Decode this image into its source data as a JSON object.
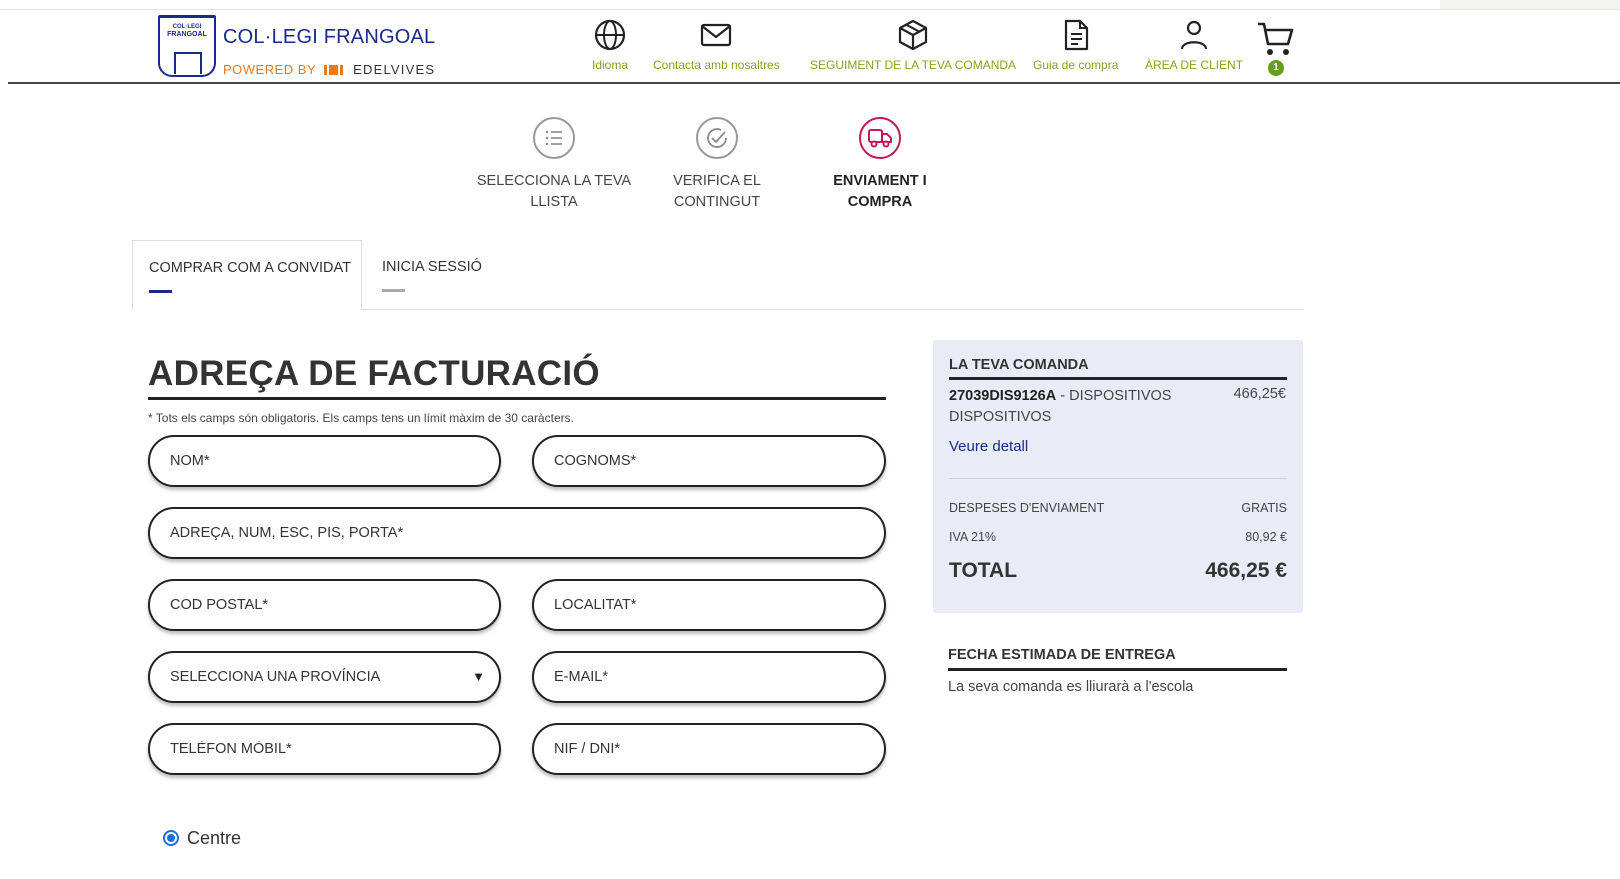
{
  "header": {
    "logo_line1": "COL·LEGI",
    "logo_line2": "FRANGOAL",
    "school_name": "COL·LEGI FRANGOAL",
    "powered_by": "POWERED BY",
    "brand": "EDELVIVES",
    "nav": [
      {
        "label": "Idioma",
        "icon": "globe-icon"
      },
      {
        "label": "Contacta amb nosaltres",
        "icon": "mail-icon"
      },
      {
        "label": "SEGUIMENT DE LA TEVA COMANDA",
        "icon": "package-icon"
      },
      {
        "label": "Guia de compra",
        "icon": "document-icon"
      },
      {
        "label": "ÀREA DE CLIENT",
        "icon": "user-icon"
      }
    ],
    "cart_count": "1",
    "colors": {
      "brand_blue": "#1a2a8c",
      "nav_green": "#8aa020",
      "accent_orange": "#e87a1e",
      "active_step": "#c2185b"
    }
  },
  "steps": [
    {
      "line1": "SELECCIONA LA TEVA",
      "line2": "LLISTA",
      "icon": "list-icon",
      "active": false
    },
    {
      "line1": "VERIFICA EL",
      "line2": "CONTINGUT",
      "icon": "check-circle-icon",
      "active": false
    },
    {
      "line1": "ENVIAMENT I COMPRA",
      "line2": "",
      "icon": "truck-icon",
      "active": true
    }
  ],
  "tabs": [
    {
      "label": "COMPRAR COM A CONVIDAT",
      "active": true
    },
    {
      "label": "INICIA SESSIÓ",
      "active": false
    }
  ],
  "billing": {
    "title": "ADREÇA DE FACTURACIÓ",
    "note": "* Tots els camps són obligatoris. Els camps tens un límit màxim de 30 caràcters.",
    "fields": {
      "nom": "NOM*",
      "cognoms": "COGNOMS*",
      "adreca": "ADREÇA, NUM, ESC, PIS, PORTA*",
      "cod_postal": "COD POSTAL*",
      "localitat": "LOCALITAT*",
      "provincia": "SELECCIONA UNA PROVÍNCIA",
      "email": "E-MAIL*",
      "telefon": "TELÈFON MÒBIL*",
      "nif": "NIF / DNI*"
    },
    "radio_label": "Centre"
  },
  "order": {
    "title": "LA TEVA COMANDA",
    "item_code": "27039DIS9126A",
    "item_desc": " - DISPOSITIVOS DISPOSITIVOS",
    "item_price": "466,25€",
    "detail_link": "Veure detall",
    "shipping_label": "DESPESES D'ENVIAMENT",
    "shipping_value": "GRATIS",
    "vat_label": "IVA 21%",
    "vat_value": "80,92 €",
    "total_label": "TOTAL",
    "total_value": "466,25 €"
  },
  "delivery": {
    "title": "FECHA ESTIMADA DE ENTREGA",
    "text": "La seva comanda es lliurarà a l'escola"
  }
}
